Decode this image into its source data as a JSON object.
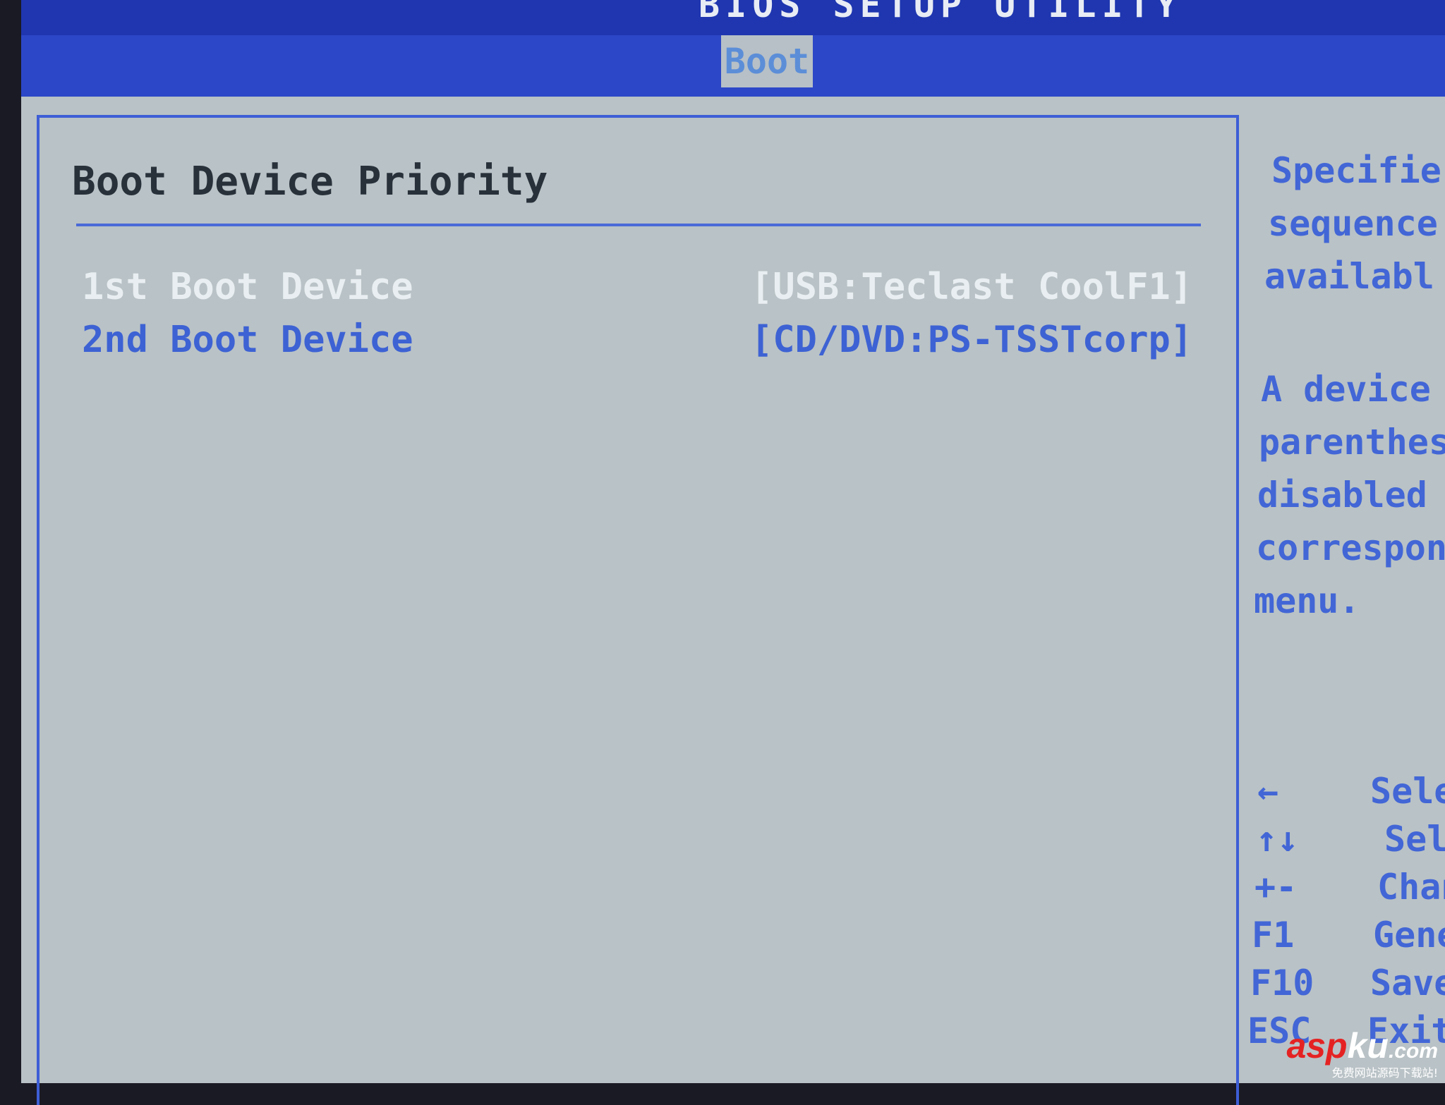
{
  "header": {
    "title": "BIOS SETUP UTILITY",
    "active_tab": "Boot"
  },
  "main": {
    "heading": "Boot Device Priority",
    "items": [
      {
        "label": "1st Boot Device",
        "value": "[USB:Teclast CoolF1]",
        "selected": true
      },
      {
        "label": "2nd Boot Device",
        "value": "[CD/DVD:PS-TSSTcorp]",
        "selected": false
      }
    ]
  },
  "help": {
    "lines": [
      "Specifie",
      "sequence",
      "availabl",
      "",
      "A device",
      "parenthes",
      "disabled",
      "correspon",
      "menu."
    ]
  },
  "keys": [
    {
      "key": "←",
      "desc": "Selec"
    },
    {
      "key": "↑↓",
      "desc": "Sele"
    },
    {
      "key": "+-",
      "desc": "Chan"
    },
    {
      "key": "F1",
      "desc": "Gener"
    },
    {
      "key": "F10",
      "desc": "Save"
    },
    {
      "key": "ESC",
      "desc": "Exit"
    }
  ],
  "watermark": {
    "logo": "aspku.com",
    "tagline": "免费网站源码下载站!"
  },
  "colors": {
    "bar": "#2c47c8",
    "panel": "#b9c2c6",
    "text_blue": "#4266d6",
    "selected": "#e8eef2"
  }
}
